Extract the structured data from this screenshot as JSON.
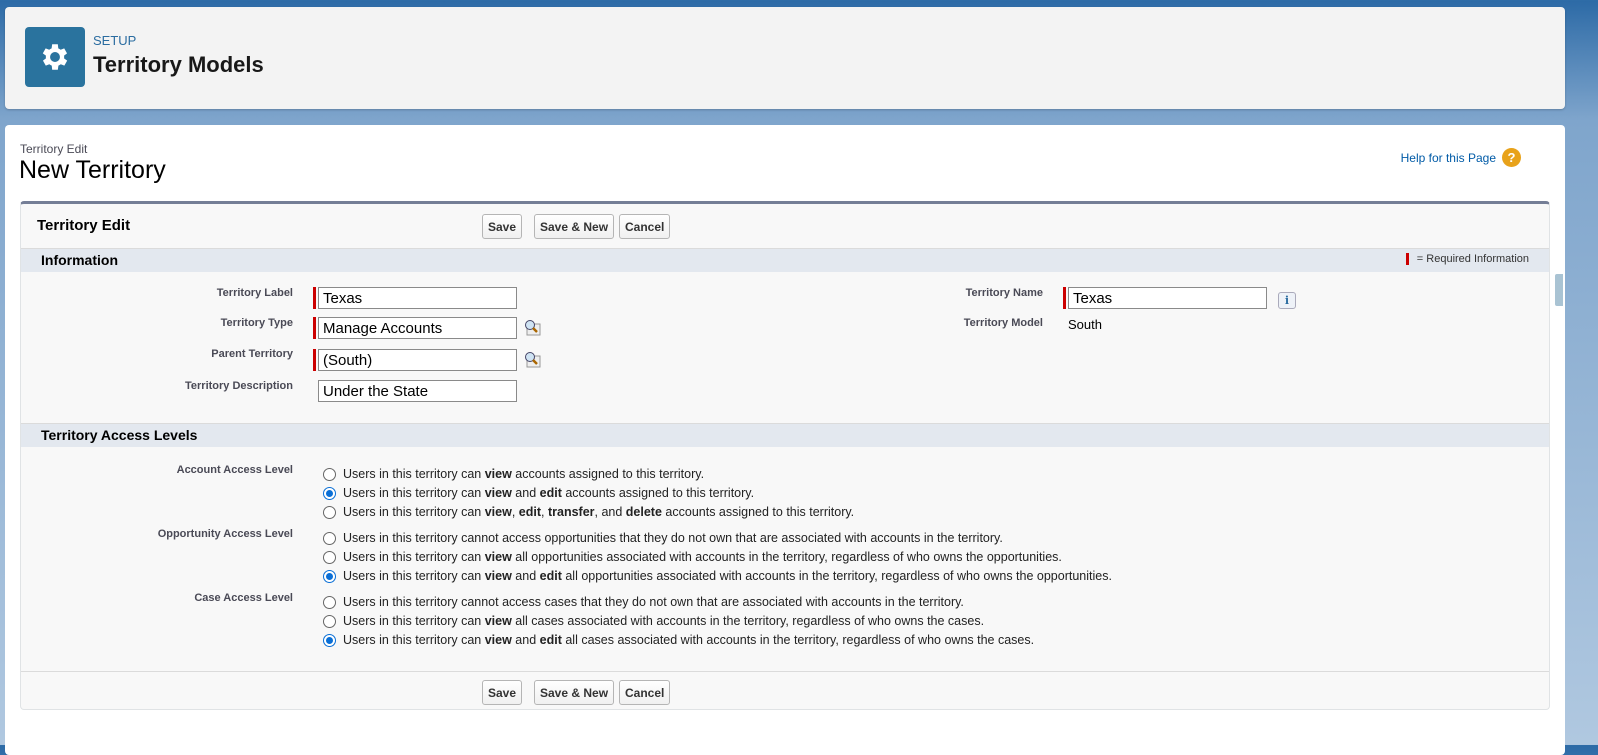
{
  "header": {
    "setup": "SETUP",
    "title": "Territory Models",
    "icon": "gear-icon"
  },
  "page": {
    "subtitle": "Territory Edit",
    "title": "New Territory",
    "help": "Help for this Page"
  },
  "block": {
    "title": "Territory Edit",
    "save": "Save",
    "save_new": "Save & New",
    "cancel": "Cancel"
  },
  "information": {
    "title": "Information",
    "required": "= Required Information",
    "territory_label": {
      "label": "Territory Label",
      "value": "Texas"
    },
    "territory_type": {
      "label": "Territory Type",
      "value": "Manage Accounts"
    },
    "parent_territory": {
      "label": "Parent Territory",
      "value": "(South)"
    },
    "territory_description": {
      "label": "Territory Description",
      "value": "Under the State"
    },
    "territory_name": {
      "label": "Territory Name",
      "value": "Texas"
    },
    "territory_model": {
      "label": "Territory Model",
      "value": "South"
    }
  },
  "access": {
    "title": "Territory Access Levels",
    "groups": [
      {
        "label": "Account Access Level",
        "options": [
          {
            "checked": false,
            "parts": [
              [
                "Users in this territory can ",
                0
              ],
              [
                "view",
                1
              ],
              [
                " accounts assigned to this territory.",
                0
              ]
            ]
          },
          {
            "checked": true,
            "parts": [
              [
                "Users in this territory can ",
                0
              ],
              [
                "view",
                1
              ],
              [
                " and ",
                0
              ],
              [
                "edit",
                1
              ],
              [
                " accounts assigned to this territory.",
                0
              ]
            ]
          },
          {
            "checked": false,
            "parts": [
              [
                "Users in this territory can ",
                0
              ],
              [
                "view",
                1
              ],
              [
                ", ",
                0
              ],
              [
                "edit",
                1
              ],
              [
                ", ",
                0
              ],
              [
                "transfer",
                1
              ],
              [
                ", and ",
                0
              ],
              [
                "delete",
                1
              ],
              [
                " accounts assigned to this territory.",
                0
              ]
            ]
          }
        ]
      },
      {
        "label": "Opportunity Access Level",
        "options": [
          {
            "checked": false,
            "parts": [
              [
                "Users in this territory cannot access opportunities that they do not own that are associated with accounts in the territory.",
                0
              ]
            ]
          },
          {
            "checked": false,
            "parts": [
              [
                "Users in this territory can ",
                0
              ],
              [
                "view",
                1
              ],
              [
                " all opportunities associated with accounts in the territory, regardless of who owns the opportunities.",
                0
              ]
            ]
          },
          {
            "checked": true,
            "parts": [
              [
                "Users in this territory can ",
                0
              ],
              [
                "view",
                1
              ],
              [
                " and ",
                0
              ],
              [
                "edit",
                1
              ],
              [
                " all opportunities associated with accounts in the territory, regardless of who owns the opportunities.",
                0
              ]
            ]
          }
        ]
      },
      {
        "label": "Case Access Level",
        "options": [
          {
            "checked": false,
            "parts": [
              [
                "Users in this territory cannot access cases that they do not own that are associated with accounts in the territory.",
                0
              ]
            ]
          },
          {
            "checked": false,
            "parts": [
              [
                "Users in this territory can ",
                0
              ],
              [
                "view",
                1
              ],
              [
                " all cases associated with accounts in the territory, regardless of who owns the cases.",
                0
              ]
            ]
          },
          {
            "checked": true,
            "parts": [
              [
                "Users in this territory can ",
                0
              ],
              [
                "view",
                1
              ],
              [
                " and ",
                0
              ],
              [
                "edit",
                1
              ],
              [
                " all cases associated with accounts in the territory, regardless of who owns the cases.",
                0
              ]
            ]
          }
        ]
      }
    ]
  }
}
